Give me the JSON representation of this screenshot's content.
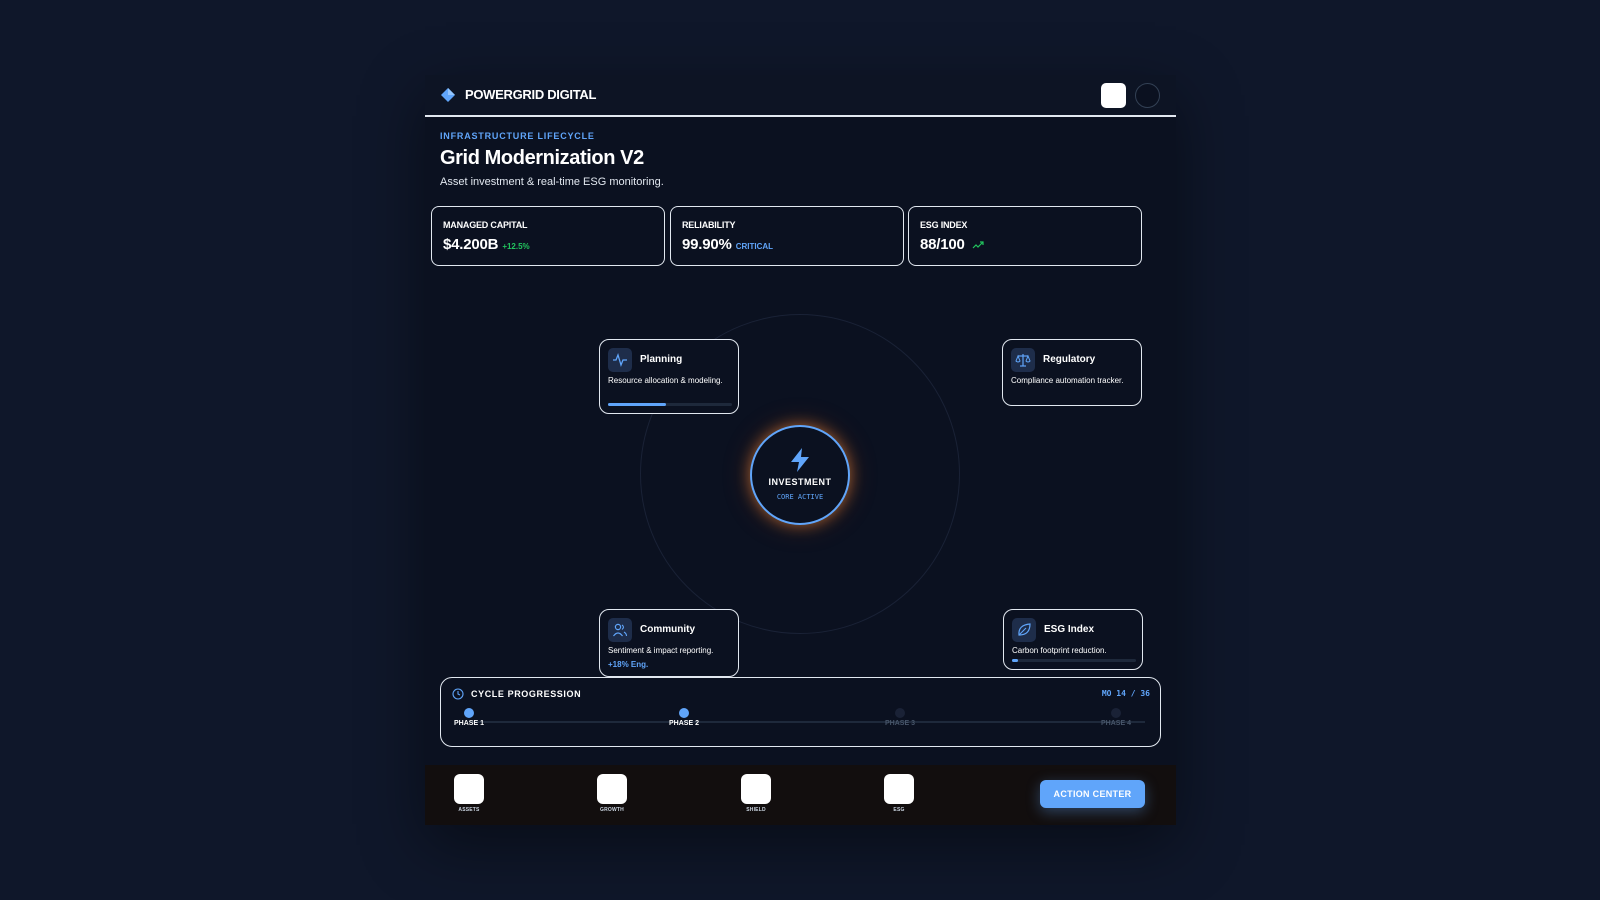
{
  "header": {
    "brand": "POWERGRID DIGITAL"
  },
  "page": {
    "overline": "INFRASTRUCTURE LIFECYCLE",
    "title": "Grid Modernization V2",
    "subtitle": "Asset investment & real-time ESG monitoring."
  },
  "stats": [
    {
      "label": "MANAGED CAPITAL",
      "value": "$4.200B",
      "extra": "+12.5%",
      "extra_color": "#22c55e"
    },
    {
      "label": "RELIABILITY",
      "value": "99.90%",
      "extra": "CRITICAL",
      "extra_color": "#60a5fa"
    },
    {
      "label": "ESG INDEX",
      "value": "88/100",
      "extra_icon": "trending-up-icon"
    }
  ],
  "core": {
    "label": "INVESTMENT",
    "status": "CORE ACTIVE",
    "icon": "lightning-bolt-icon"
  },
  "nodes": {
    "planning": {
      "title": "Planning",
      "desc": "Resource allocation & modeling.",
      "progress": 0.47,
      "icon": "activity-icon"
    },
    "regulatory": {
      "title": "Regulatory",
      "desc": "Compliance automation tracker.",
      "icon": "scale-icon"
    },
    "community": {
      "title": "Community",
      "desc": "Sentiment & impact reporting.",
      "meta": "+18% Eng.",
      "icon": "users-icon"
    },
    "esg": {
      "title": "ESG Index",
      "desc": "Carbon footprint reduction.",
      "progress": 0.05,
      "icon": "leaf-icon"
    }
  },
  "progression": {
    "title": "CYCLE PROGRESSION",
    "month": "MO 14 / 36",
    "phases": [
      {
        "label": "PHASE 1",
        "active": true
      },
      {
        "label": "PHASE 2",
        "active": true
      },
      {
        "label": "PHASE 3",
        "active": false
      },
      {
        "label": "PHASE 4",
        "active": false
      }
    ]
  },
  "nav": {
    "items": [
      "ASSETS",
      "GROWTH",
      "SHIELD",
      "ESG"
    ],
    "action": "ACTION CENTER"
  },
  "colors": {
    "background": "#0f172a",
    "panel": "#0b1120",
    "accent": "#60a5fa",
    "positive": "#22c55e"
  }
}
